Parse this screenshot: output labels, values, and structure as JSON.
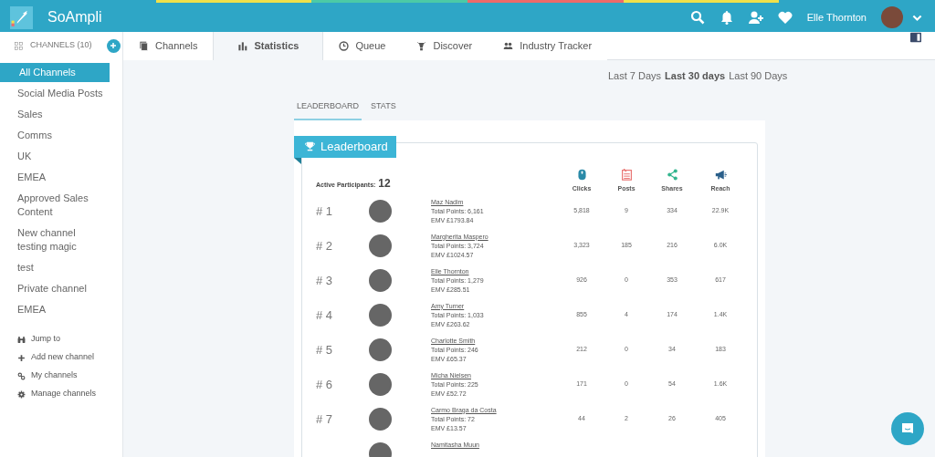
{
  "app": {
    "title": "SoAmpli",
    "user_name": "Elle Thornton"
  },
  "nav_tabs": [
    {
      "label": "Channels",
      "kind": "pages",
      "selected": false
    },
    {
      "label": "Statistics",
      "kind": "bars",
      "selected": true
    },
    {
      "label": "Queue",
      "kind": "clock",
      "selected": false
    },
    {
      "label": "Discover",
      "kind": "lamp",
      "selected": false
    },
    {
      "label": "Industry Tracker",
      "kind": "users",
      "selected": false
    }
  ],
  "sidebar": {
    "heading": "CHANNELS (10)",
    "items": [
      {
        "label": "All Channels",
        "selected": true
      },
      {
        "label": "Social Media Posts",
        "selected": false
      },
      {
        "label": "Sales",
        "selected": false
      },
      {
        "label": "Comms",
        "selected": false
      },
      {
        "label": "UK",
        "selected": false
      },
      {
        "label": "EMEA",
        "selected": false
      },
      {
        "label": "Approved Sales Content",
        "selected": false
      },
      {
        "label": "New channel testing magic",
        "selected": false
      },
      {
        "label": "test",
        "selected": false
      },
      {
        "label": "Private channel",
        "selected": false
      },
      {
        "label": "EMEA",
        "selected": false
      }
    ],
    "links": [
      {
        "label": "Jump to",
        "kind": "binoculars"
      },
      {
        "label": "Add new channel",
        "kind": "plus"
      },
      {
        "label": "My channels",
        "kind": "link"
      },
      {
        "label": "Manage channels",
        "kind": "gear"
      }
    ]
  },
  "date_ranges": [
    {
      "label": "Last 7 Days",
      "selected": false
    },
    {
      "label": "Last 30 days",
      "selected": true
    },
    {
      "label": "Last 90 Days",
      "selected": false
    }
  ],
  "sub_tabs": [
    {
      "label": "LEADERBOARD",
      "selected": true
    },
    {
      "label": "STATS",
      "selected": false
    }
  ],
  "leaderboard": {
    "title": "Leaderboard",
    "participants_label": "Active Participants:",
    "participants": "12",
    "columns": [
      {
        "label": "Clicks",
        "kind": "mouse"
      },
      {
        "label": "Posts",
        "kind": "document"
      },
      {
        "label": "Shares",
        "kind": "share"
      },
      {
        "label": "Reach",
        "kind": "megaphone"
      }
    ],
    "rows": [
      {
        "rank": "# 1",
        "name": "Maz Nadim",
        "points": "Total Points: 6,161",
        "emv": "EMV £1793.84",
        "clicks": "5,818",
        "posts": "9",
        "shares": "334",
        "reach": "22.9K"
      },
      {
        "rank": "# 2",
        "name": "Margherita Maspero",
        "points": "Total Points: 3,724",
        "emv": "EMV £1024.57",
        "clicks": "3,323",
        "posts": "185",
        "shares": "216",
        "reach": "6.0K"
      },
      {
        "rank": "# 3",
        "name": "Elle Thornton",
        "points": "Total Points: 1,279",
        "emv": "EMV £285.51",
        "clicks": "926",
        "posts": "0",
        "shares": "353",
        "reach": "617"
      },
      {
        "rank": "# 4",
        "name": "Amy Turner",
        "points": "Total Points: 1,033",
        "emv": "EMV £263.62",
        "clicks": "855",
        "posts": "4",
        "shares": "174",
        "reach": "1.4K"
      },
      {
        "rank": "# 5",
        "name": "Charlotte Smith",
        "points": "Total Points: 246",
        "emv": "EMV £65.37",
        "clicks": "212",
        "posts": "0",
        "shares": "34",
        "reach": "183"
      },
      {
        "rank": "# 6",
        "name": "Micha Nielsen",
        "points": "Total Points: 225",
        "emv": "EMV £52.72",
        "clicks": "171",
        "posts": "0",
        "shares": "54",
        "reach": "1.6K"
      },
      {
        "rank": "# 7",
        "name": "Carmo Braga da Costa",
        "points": "Total Points: 72",
        "emv": "EMV £13.57",
        "clicks": "44",
        "posts": "2",
        "shares": "26",
        "reach": "405"
      },
      {
        "name": "Namitasha Muun"
      }
    ]
  }
}
